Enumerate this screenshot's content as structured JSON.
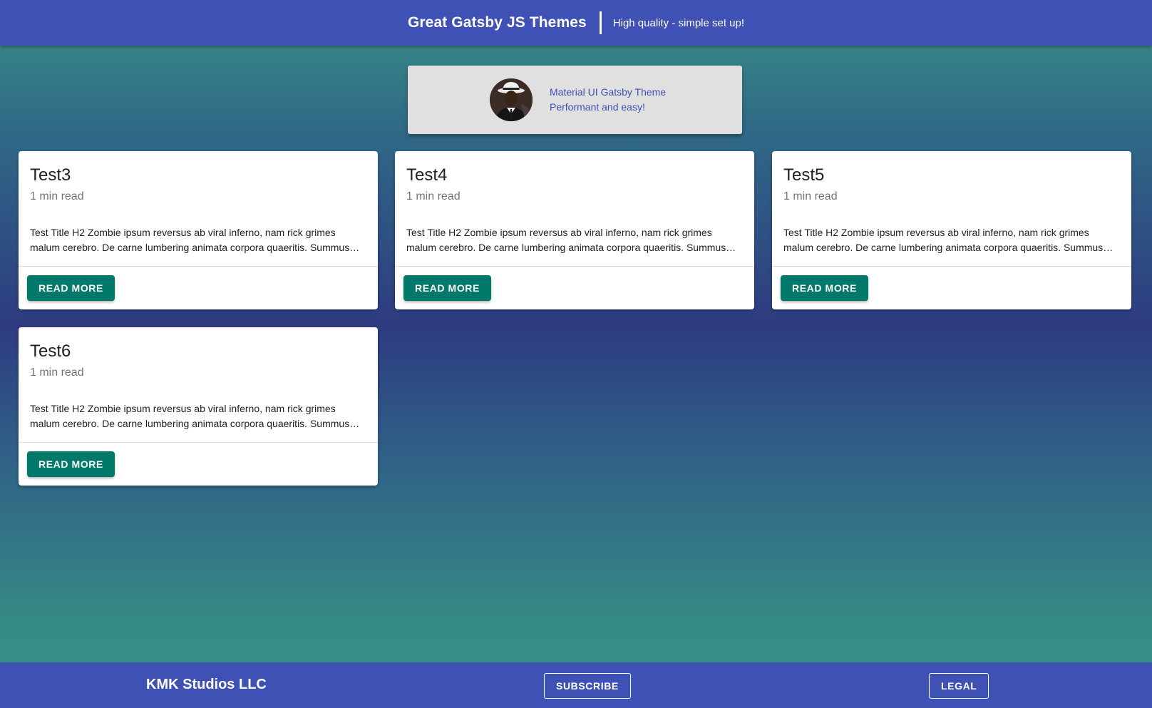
{
  "header": {
    "title": "Great Gatsby JS Themes",
    "tagline": "High quality - simple set up!"
  },
  "hero": {
    "line1": "Material UI Gatsby Theme",
    "line2": "Performant and easy!"
  },
  "posts": [
    {
      "title": "Test3",
      "read_time": "1 min read",
      "excerpt": "Test Title H2 Zombie ipsum reversus ab viral inferno, nam rick grimes malum cerebro. De carne lumbering animata corpora quaeritis. Summus…",
      "button_label": "READ MORE"
    },
    {
      "title": "Test4",
      "read_time": "1 min read",
      "excerpt": "Test Title H2 Zombie ipsum reversus ab viral inferno, nam rick grimes malum cerebro. De carne lumbering animata corpora quaeritis. Summus…",
      "button_label": "READ MORE"
    },
    {
      "title": "Test5",
      "read_time": "1 min read",
      "excerpt": "Test Title H2 Zombie ipsum reversus ab viral inferno, nam rick grimes malum cerebro. De carne lumbering animata corpora quaeritis. Summus…",
      "button_label": "READ MORE"
    },
    {
      "title": "Test6",
      "read_time": "1 min read",
      "excerpt": "Test Title H2 Zombie ipsum reversus ab viral inferno, nam rick grimes malum cerebro. De carne lumbering animata corpora quaeritis. Summus…",
      "button_label": "READ MORE"
    }
  ],
  "footer": {
    "company": "KMK Studios LLC",
    "subscribe_label": "SUBSCRIBE",
    "legal_label": "LEGAL"
  },
  "colors": {
    "primary": "#3f51b5",
    "button": "#00796b",
    "hero_bg": "#e0e0e0"
  }
}
